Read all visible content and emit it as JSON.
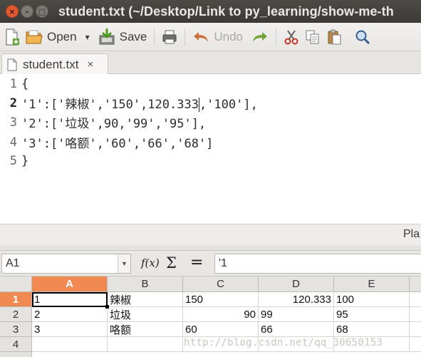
{
  "editor_window": {
    "title": "student.txt (~/Desktop/Link to py_learning/show-me-th",
    "window_controls": {
      "close": "×",
      "minimize": "–",
      "maximize": "□"
    },
    "toolbar": {
      "open_label": "Open",
      "save_label": "Save",
      "undo_label": "Undo",
      "open_dropdown": "▾"
    },
    "tab": {
      "label": "student.txt",
      "close": "×"
    },
    "lines": [
      {
        "num": "1",
        "text": "{"
      },
      {
        "num": "2",
        "text_before_cursor": "'1':['辣椒','150',120.333",
        "text_after_cursor": ",'100'],",
        "current": true
      },
      {
        "num": "3",
        "text": "'2':['垃圾',90,'99','95'],"
      },
      {
        "num": "4",
        "text": "'3':['咯额','60','66','68']"
      },
      {
        "num": "5",
        "text": "}"
      }
    ],
    "status": {
      "language": "Pla"
    }
  },
  "spreadsheet": {
    "name_box": "A1",
    "formula_buttons": {
      "function_wizard": "f(x)",
      "sum": "Σ",
      "equals": "="
    },
    "formula_value": "'1",
    "columns": [
      "A",
      "B",
      "C",
      "D",
      "E"
    ],
    "active_column": "A",
    "rows": [
      {
        "num": "1",
        "active": true,
        "cells": [
          "1",
          "辣椒",
          "150",
          "120.333",
          "100"
        ]
      },
      {
        "num": "2",
        "cells": [
          "2",
          "垃圾",
          "90",
          "99",
          "95"
        ]
      },
      {
        "num": "3",
        "cells": [
          "3",
          "咯额",
          "60",
          "66",
          "68"
        ]
      },
      {
        "num": "4",
        "cells": [
          "",
          "",
          "",
          "",
          ""
        ]
      }
    ],
    "selected_cell": "A1"
  },
  "watermark": "http://blog.csdn.net/qq_30650153",
  "colors": {
    "titlebar": "#3b3a36",
    "close_button": "#e35a32",
    "active_header": "#f18a52",
    "undo_arrow": "#d0703f",
    "redo_arrow": "#73a33b"
  }
}
